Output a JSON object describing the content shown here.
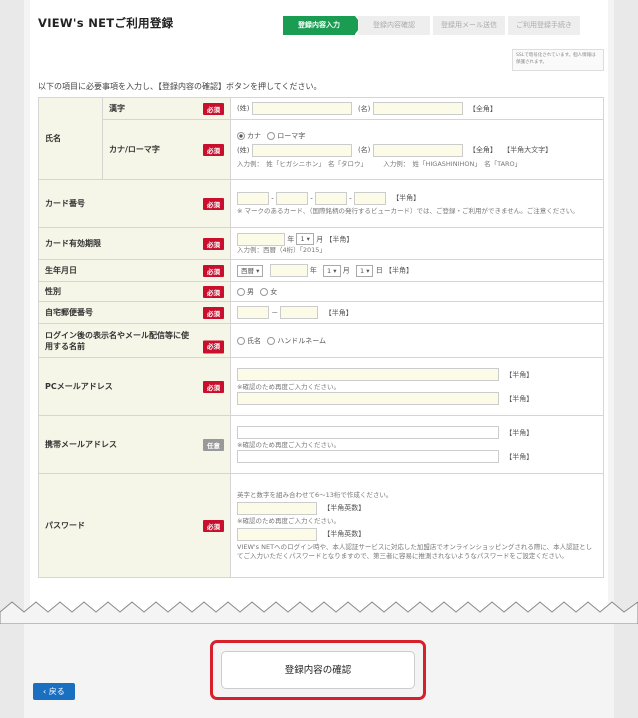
{
  "header": {
    "title": "VIEW's NETご利用登録"
  },
  "steps": [
    "登録内容入力",
    "登録内容確認",
    "登録用メール送信",
    "ご利用登録手続き"
  ],
  "security_badge": {
    "text": "SSLで暗号化されています。個人情報は保護されます。"
  },
  "intro": "以下の項目に必要事項を入力し、【登録内容の確認】ボタンを押してください。",
  "required_label": "必須",
  "optional_label": "任意",
  "fields": {
    "name": {
      "label": "氏名",
      "kanji_label": "漢字",
      "kana_label": "カナ/ローマ字",
      "sei": "(姓)",
      "mei": "(名)",
      "zenkaku": "【全角】",
      "hankaku_upper": "【半角大文字】",
      "kana_option": "カナ",
      "roman_option": "ローマ字",
      "example": "入力例：　姓「ヒガシニホン」　名「タロウ」　　　入力例：　姓「HIGASHINIHON」　名「TARO」"
    },
    "card_number": {
      "label": "カード番号",
      "hankaku": "【半角】",
      "note": "※ マークのあるカード、（国際銘柄の発行するビューカード）では、ご登録・ご利用ができません。ご注意ください。"
    },
    "card_expiry": {
      "label": "カード有効期限",
      "year_unit": "年",
      "month_unit": "月",
      "month_value": "1",
      "hankaku": "【半角】",
      "example": "入力例：西暦（4桁）「2015」"
    },
    "birth_date": {
      "label": "生年月日",
      "era": "西暦",
      "year_unit": "年",
      "month_unit": "月",
      "day_unit": "日",
      "month_value": "1",
      "day_value": "1",
      "hankaku": "【半角】"
    },
    "gender": {
      "label": "性別",
      "male": "男",
      "female": "女"
    },
    "postal": {
      "label": "自宅郵便番号",
      "dash": "－",
      "hankaku": "【半角】"
    },
    "display_name": {
      "label": "ログイン後の表示名やメール配信等に使用する名前",
      "name_option": "氏名",
      "handle_option": "ハンドルネーム"
    },
    "pc_email": {
      "label": "PCメールアドレス",
      "hankaku": "【半角】",
      "confirm_note": "※確認のため再度ご入力ください。"
    },
    "mobile_email": {
      "label": "携帯メールアドレス",
      "hankaku": "【半角】",
      "confirm_note": "※確認のため再度ご入力ください。"
    },
    "password": {
      "label": "パスワード",
      "rule": "英字と数字を組み合わせて6～13桁で作成ください。",
      "hankaku_eisu": "【半角英数】",
      "confirm_note": "※確認のため再度ご入力ください。",
      "description": "VIEW's NETへのログイン時や、本人認証サービスに対応した加盟店でオンラインショッピングされる際に、本人認証としてご入力いただくパスワードとなりますので、第三者に容易に推測されないようなパスワードをご設定ください。"
    }
  },
  "buttons": {
    "confirm": "登録内容の確認",
    "back": "戻る"
  },
  "colors": {
    "accent": "#1a9c52",
    "required": "#c8102e",
    "highlight": "#d8202c",
    "back": "#1b6fc0"
  }
}
